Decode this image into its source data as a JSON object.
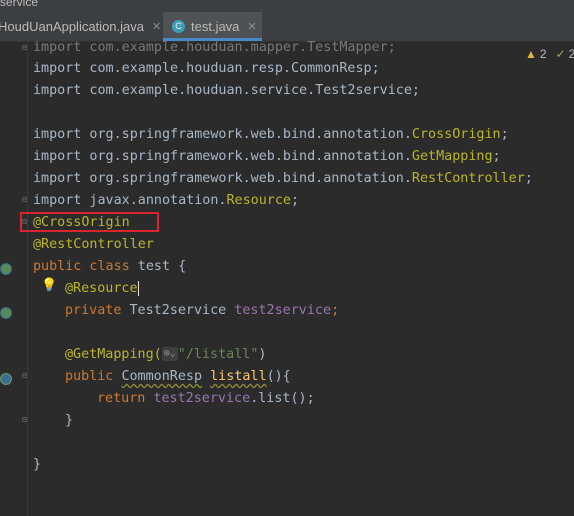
{
  "window": {
    "breadcrumb": "service"
  },
  "tabs": [
    {
      "label": "HoudUanApplication.java",
      "active": false
    },
    {
      "label": "test.java",
      "active": true
    }
  ],
  "status": {
    "warnings": "2",
    "checks": "2"
  },
  "code": {
    "l1": "import com.example.houduan.mapper.TestMapper;",
    "l2": "import com.example.houduan.resp.CommonResp;",
    "l3": "import com.example.houduan.service.Test2service;",
    "l4_pre": "import org.springframework.web.bind.annotation.",
    "l4_cls": "CrossOrigin",
    "l5_pre": "import org.springframework.web.bind.annotation.",
    "l5_cls": "GetMapping",
    "l6_pre": "import org.springframework.web.bind.annotation.",
    "l6_cls": "RestController",
    "l8_pre": "import javax.annotation.",
    "l8_cls": "Resource",
    "l9": "@CrossOrigin",
    "l10": "@RestController",
    "l11_kw": "public class",
    "l11_rest": " test {",
    "l12": "@Resource",
    "l13_kw": "private",
    "l13_type": " Test2service ",
    "l13_field": "test2service",
    "l15_ann": "@GetMapping(",
    "l15_str": "\"/listall\"",
    "l15_end": ")",
    "l16_kw": "public",
    "l16_type": "CommonResp",
    "l16_name": "listall",
    "l16_end": "(){",
    "l17_kw": "return",
    "l17_field": "test2service",
    "l17_end": ".list();",
    "l18": "}",
    "l20": "}"
  },
  "icons": [
    "close-icon",
    "class-file-icon",
    "warning-icon",
    "check-icon",
    "bulb-icon",
    "spring-bean-icon",
    "fold-icon"
  ]
}
